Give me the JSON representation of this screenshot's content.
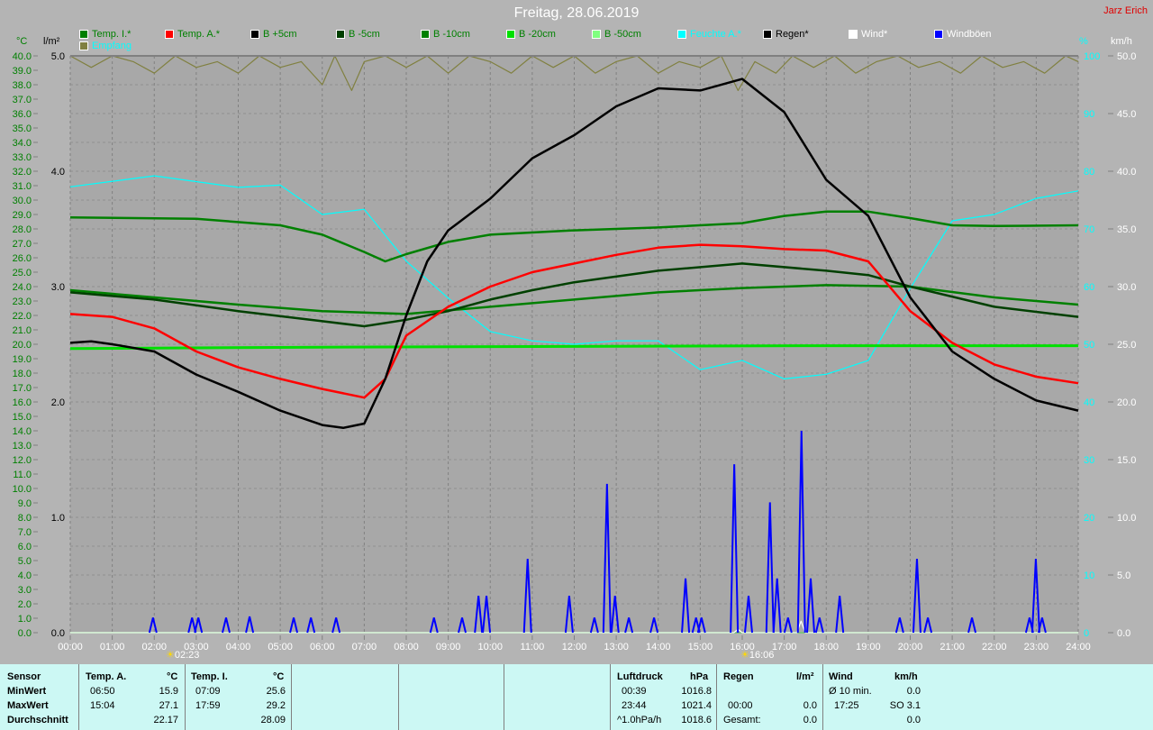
{
  "header": {
    "title": "Freitag, 28.06.2019",
    "author": "Jarz Erich"
  },
  "legend": [
    {
      "label": "Temp. I.*",
      "color": "#008000",
      "text_color": "#008000"
    },
    {
      "label": "Temp. A.*",
      "color": "#ff0000",
      "text_color": "#008000"
    },
    {
      "label": "B +5cm",
      "color": "#000000",
      "text_color": "#008000"
    },
    {
      "label": "B -5cm",
      "color": "#004000",
      "text_color": "#008000"
    },
    {
      "label": "B -10cm",
      "color": "#008000",
      "text_color": "#008000"
    },
    {
      "label": "B -20cm",
      "color": "#00e000",
      "text_color": "#008000"
    },
    {
      "label": "B -50cm",
      "color": "#80ff80",
      "text_color": "#008000"
    },
    {
      "label": "Feuchte A.*",
      "color": "#00ffff",
      "text_color": "#00ffff"
    },
    {
      "label": "Regen*",
      "color": "#000000",
      "text_color": "#000000"
    },
    {
      "label": "Wind*",
      "color": "#ffffff",
      "text_color": "#ffffff"
    },
    {
      "label": "Windböen",
      "color": "#0000ff",
      "text_color": "#ffffff"
    },
    {
      "label": "Empfang",
      "color": "#808040",
      "text_color": "#00ffff"
    }
  ],
  "axes": {
    "left_unit": "°C",
    "rain_unit": "l/m²",
    "hum_unit": "%",
    "wind_unit": "km/h"
  },
  "markers": {
    "sunrise": "02:23",
    "sunset": "16:06"
  },
  "chart_data": {
    "type": "line",
    "title": "Freitag, 28.06.2019",
    "x_range_hours": [
      0,
      24
    ],
    "x_ticks": [
      "00:00",
      "01:00",
      "02:00",
      "03:00",
      "04:00",
      "05:00",
      "06:00",
      "07:00",
      "08:00",
      "09:00",
      "10:00",
      "11:00",
      "12:00",
      "13:00",
      "14:00",
      "15:00",
      "16:00",
      "17:00",
      "18:00",
      "19:00",
      "20:00",
      "21:00",
      "22:00",
      "23:00",
      "24:00"
    ],
    "ylim_temp": [
      0,
      40
    ],
    "ylim_rain": [
      0,
      5
    ],
    "ylim_hum": [
      0,
      100
    ],
    "ylim_wind": [
      0,
      50
    ],
    "series": [
      {
        "name": "Temp. I.*",
        "axis": "temp",
        "color": "#008000",
        "points": [
          [
            0,
            28.8
          ],
          [
            3,
            28.7
          ],
          [
            5,
            28.25
          ],
          [
            6,
            27.6
          ],
          [
            7,
            26.4
          ],
          [
            7.5,
            25.75
          ],
          [
            8,
            26.25
          ],
          [
            9,
            27.1
          ],
          [
            10,
            27.6
          ],
          [
            12,
            27.9
          ],
          [
            14,
            28.1
          ],
          [
            16,
            28.4
          ],
          [
            17,
            28.9
          ],
          [
            18,
            29.2
          ],
          [
            19,
            29.2
          ],
          [
            20,
            28.75
          ],
          [
            21,
            28.25
          ],
          [
            22,
            28.2
          ],
          [
            24,
            28.25
          ]
        ]
      },
      {
        "name": "B -20cm",
        "axis": "temp",
        "color": "#00e000",
        "points": [
          [
            0,
            19.7
          ],
          [
            6,
            19.8
          ],
          [
            12,
            19.85
          ],
          [
            18,
            19.9
          ],
          [
            24,
            19.9
          ]
        ]
      },
      {
        "name": "B -10cm",
        "axis": "temp",
        "color": "#008000",
        "points": [
          [
            0,
            23.75
          ],
          [
            2,
            23.25
          ],
          [
            4,
            22.75
          ],
          [
            6,
            22.3
          ],
          [
            8,
            22.1
          ],
          [
            10,
            22.6
          ],
          [
            12,
            23.1
          ],
          [
            14,
            23.6
          ],
          [
            16,
            23.9
          ],
          [
            18,
            24.1
          ],
          [
            20,
            24.0
          ],
          [
            22,
            23.25
          ],
          [
            24,
            22.75
          ]
        ]
      },
      {
        "name": "B -5cm",
        "axis": "temp",
        "color": "#004000",
        "points": [
          [
            0,
            23.6
          ],
          [
            2,
            23.1
          ],
          [
            4,
            22.3
          ],
          [
            6,
            21.6
          ],
          [
            7,
            21.25
          ],
          [
            8,
            21.7
          ],
          [
            9,
            22.3
          ],
          [
            10,
            23.1
          ],
          [
            11,
            23.75
          ],
          [
            12,
            24.3
          ],
          [
            14,
            25.1
          ],
          [
            16,
            25.6
          ],
          [
            18,
            25.1
          ],
          [
            19,
            24.8
          ],
          [
            20,
            24.0
          ],
          [
            22,
            22.6
          ],
          [
            24,
            21.9
          ]
        ]
      },
      {
        "name": "Temp. A.*",
        "axis": "temp",
        "color": "#ff0000",
        "points": [
          [
            0,
            22.1
          ],
          [
            1,
            21.9
          ],
          [
            2,
            21.1
          ],
          [
            3,
            19.5
          ],
          [
            4,
            18.4
          ],
          [
            5,
            17.6
          ],
          [
            6,
            16.9
          ],
          [
            7,
            16.3
          ],
          [
            7.5,
            17.6
          ],
          [
            8,
            20.6
          ],
          [
            9,
            22.6
          ],
          [
            10,
            24.0
          ],
          [
            11,
            25.0
          ],
          [
            12,
            25.6
          ],
          [
            13,
            26.2
          ],
          [
            14,
            26.7
          ],
          [
            15,
            26.9
          ],
          [
            16,
            26.8
          ],
          [
            17,
            26.6
          ],
          [
            18,
            26.5
          ],
          [
            19,
            25.75
          ],
          [
            20,
            22.3
          ],
          [
            21,
            20.1
          ],
          [
            22,
            18.6
          ],
          [
            23,
            17.75
          ],
          [
            24,
            17.3
          ]
        ]
      },
      {
        "name": "B +5cm",
        "axis": "temp",
        "color": "#000000",
        "points": [
          [
            0,
            20.1
          ],
          [
            0.5,
            20.2
          ],
          [
            1,
            20.0
          ],
          [
            2,
            19.5
          ],
          [
            3,
            17.9
          ],
          [
            4,
            16.7
          ],
          [
            5,
            15.4
          ],
          [
            6,
            14.4
          ],
          [
            6.5,
            14.2
          ],
          [
            7,
            14.5
          ],
          [
            7.5,
            17.6
          ],
          [
            8,
            22.0
          ],
          [
            8.5,
            25.75
          ],
          [
            9,
            27.9
          ],
          [
            10,
            30.1
          ],
          [
            11,
            32.9
          ],
          [
            12,
            34.5
          ],
          [
            13,
            36.5
          ],
          [
            14,
            37.75
          ],
          [
            15,
            37.6
          ],
          [
            16,
            38.4
          ],
          [
            17,
            36.1
          ],
          [
            18,
            31.4
          ],
          [
            19,
            28.9
          ],
          [
            20,
            23.25
          ],
          [
            21,
            19.5
          ],
          [
            22,
            17.6
          ],
          [
            23,
            16.1
          ],
          [
            24,
            15.4
          ]
        ]
      },
      {
        "name": "Feuchte A.*",
        "axis": "hum",
        "color": "#00ffff",
        "points": [
          [
            0,
            77.3
          ],
          [
            2,
            79.2
          ],
          [
            4,
            77.2
          ],
          [
            5,
            77.6
          ],
          [
            6,
            72.5
          ],
          [
            7,
            73.4
          ],
          [
            8,
            64.4
          ],
          [
            9,
            58
          ],
          [
            10,
            52.2
          ],
          [
            11,
            50.6
          ],
          [
            12,
            50
          ],
          [
            13,
            50.6
          ],
          [
            14,
            50.6
          ],
          [
            15,
            45.6
          ],
          [
            16,
            47.2
          ],
          [
            17,
            44
          ],
          [
            18,
            44.8
          ],
          [
            19,
            47.2
          ],
          [
            20,
            59.7
          ],
          [
            21,
            71.4
          ],
          [
            22,
            72.5
          ],
          [
            23,
            75.3
          ],
          [
            24,
            76.6
          ]
        ]
      },
      {
        "name": "Empfang",
        "axis": "hum",
        "color": "#808040",
        "points": [
          [
            0,
            100
          ],
          [
            0.5,
            98
          ],
          [
            1,
            100
          ],
          [
            1.5,
            99
          ],
          [
            2,
            97
          ],
          [
            2.5,
            100
          ],
          [
            3,
            98
          ],
          [
            3.5,
            99
          ],
          [
            4,
            97
          ],
          [
            4.5,
            100
          ],
          [
            5,
            98
          ],
          [
            5.5,
            99
          ],
          [
            6,
            95
          ],
          [
            6.3,
            100
          ],
          [
            6.7,
            94
          ],
          [
            7,
            99
          ],
          [
            7.5,
            100
          ],
          [
            8,
            98
          ],
          [
            8.5,
            100
          ],
          [
            9,
            97
          ],
          [
            9.5,
            100
          ],
          [
            10,
            99
          ],
          [
            10.5,
            97
          ],
          [
            11,
            100
          ],
          [
            11.5,
            98
          ],
          [
            12,
            100
          ],
          [
            12.5,
            97
          ],
          [
            13,
            99
          ],
          [
            13.5,
            100
          ],
          [
            14,
            97
          ],
          [
            14.5,
            99
          ],
          [
            15,
            98
          ],
          [
            15.5,
            100
          ],
          [
            15.9,
            94
          ],
          [
            16.3,
            99
          ],
          [
            16.8,
            97
          ],
          [
            17.2,
            100
          ],
          [
            17.7,
            98
          ],
          [
            18.2,
            100
          ],
          [
            18.7,
            97
          ],
          [
            19.2,
            99
          ],
          [
            19.7,
            100
          ],
          [
            20.2,
            98
          ],
          [
            20.7,
            99
          ],
          [
            21.2,
            97
          ],
          [
            21.7,
            100
          ],
          [
            22.2,
            98
          ],
          [
            22.7,
            99
          ],
          [
            23.2,
            97
          ],
          [
            23.7,
            100
          ],
          [
            24,
            99
          ]
        ]
      },
      {
        "name": "Wind*",
        "axis": "wind",
        "color": "#ffffff",
        "points": [
          [
            0,
            0
          ],
          [
            15.8,
            0
          ],
          [
            15.9,
            0.3
          ],
          [
            16.0,
            0
          ],
          [
            17.3,
            0
          ],
          [
            17.4,
            1.0
          ],
          [
            17.5,
            0
          ],
          [
            24,
            0
          ]
        ]
      }
    ],
    "gusts": {
      "name": "Windböen",
      "axis": "wind",
      "color": "#0000ff",
      "points": [
        [
          1.97,
          1.3
        ],
        [
          2.9,
          1.3
        ],
        [
          3.05,
          1.3
        ],
        [
          3.71,
          1.3
        ],
        [
          4.27,
          1.4
        ],
        [
          5.32,
          1.3
        ],
        [
          5.73,
          1.3
        ],
        [
          6.33,
          1.3
        ],
        [
          8.66,
          1.3
        ],
        [
          9.33,
          1.3
        ],
        [
          9.72,
          3.2
        ],
        [
          9.91,
          3.2
        ],
        [
          10.89,
          6.4
        ],
        [
          11.88,
          3.2
        ],
        [
          12.48,
          1.3
        ],
        [
          12.78,
          12.9
        ],
        [
          12.97,
          3.2
        ],
        [
          13.3,
          1.3
        ],
        [
          13.9,
          1.3
        ],
        [
          14.65,
          4.7
        ],
        [
          14.9,
          1.3
        ],
        [
          15.03,
          1.3
        ],
        [
          15.81,
          14.6
        ],
        [
          16.15,
          3.2
        ],
        [
          16.66,
          11.3
        ],
        [
          16.83,
          4.7
        ],
        [
          17.09,
          1.3
        ],
        [
          17.41,
          17.5
        ],
        [
          17.63,
          4.7
        ],
        [
          17.84,
          1.3
        ],
        [
          18.32,
          3.2
        ],
        [
          19.75,
          1.3
        ],
        [
          20.16,
          6.4
        ],
        [
          20.42,
          1.3
        ],
        [
          21.47,
          1.3
        ],
        [
          22.84,
          1.3
        ],
        [
          22.99,
          6.4
        ],
        [
          23.14,
          1.3
        ]
      ]
    }
  },
  "stats": {
    "sensor": "Sensor",
    "min": "MinWert",
    "max": "MaxWert",
    "avg": "Durchschnitt",
    "temp_a": {
      "label": "Temp. A.",
      "unit": "°C",
      "min_time": "06:50",
      "min": "15.9",
      "max_time": "15:04",
      "max": "27.1",
      "avg": "22.17"
    },
    "temp_i": {
      "label": "Temp. I.",
      "unit": "°C",
      "min_time": "07:09",
      "min": "25.6",
      "max_time": "17:59",
      "max": "29.2",
      "avg": "28.09"
    },
    "pressure": {
      "label": "Luftdruck",
      "unit": "hPa",
      "min_time": "00:39",
      "min": "1016.8",
      "max_time": "23:44",
      "max": "1021.4",
      "trend": "^1.0hPa/h",
      "avg": "1018.6"
    },
    "rain": {
      "label": "Regen",
      "unit": "l/m²",
      "max_time": "00:00",
      "max": "0.0",
      "total_label": "Gesamt:",
      "total": "0.0"
    },
    "wind": {
      "label": "Wind",
      "unit": "km/h",
      "avg10_label": "Ø 10 min.",
      "avg10": "0.0",
      "max_time": "17:25",
      "max": "SO 3.1",
      "avg": "0.0"
    }
  }
}
